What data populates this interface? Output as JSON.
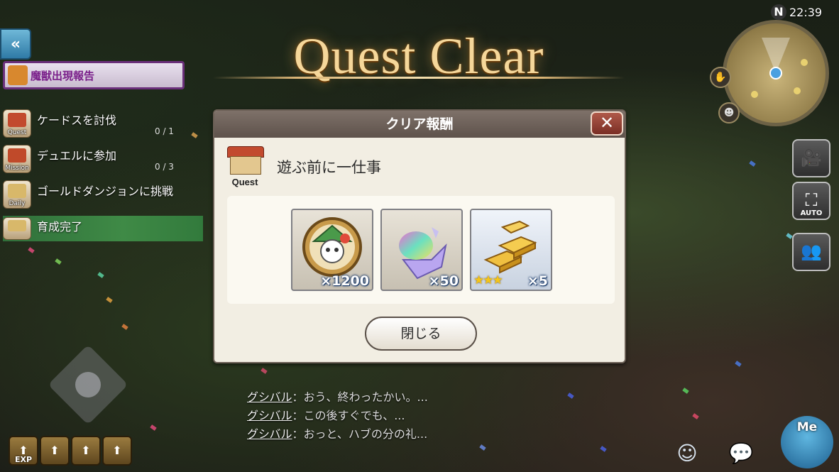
{
  "title": "Quest Clear",
  "clock": "22:39",
  "compass": "N",
  "back_button": "«",
  "event_banner": {
    "label": "魔獣出現報告"
  },
  "missions": [
    {
      "category": "Quest",
      "label": "ケードスを討伐",
      "progress": "0 / 1"
    },
    {
      "category": "Mission",
      "label": "デュエルに参加",
      "progress": "0 / 3"
    },
    {
      "category": "Daily",
      "label": "ゴールドダンジョンに挑戦",
      "progress": ""
    },
    {
      "category": "",
      "label": "育成完了",
      "progress": ""
    }
  ],
  "dialog": {
    "header": "クリア報酬",
    "close_glyph": "✕",
    "quest_icon_label": "Quest",
    "quest_name": "遊ぶ前に一仕事",
    "rewards": [
      {
        "icon": "coin-medal-icon",
        "quantity": "×1200",
        "stars": ""
      },
      {
        "icon": "rainbow-crystal-icon",
        "quantity": "×50",
        "stars": ""
      },
      {
        "icon": "gold-bars-icon",
        "quantity": "×5",
        "stars": "★★★"
      }
    ],
    "close_button": "閉じる"
  },
  "side_buttons": [
    {
      "icon": "camera-icon",
      "label": ""
    },
    {
      "icon": "auto-icon",
      "label": "AUTO"
    },
    {
      "icon": "party-icon",
      "label": ""
    }
  ],
  "chat": [
    {
      "speaker": "グシバル",
      "text": "：おう、終わったかい。..."
    },
    {
      "speaker": "グシバル",
      "text": "：この後すぐでも、..."
    },
    {
      "speaker": "グシバル",
      "text": "：おっと、ハブの分の礼..."
    }
  ],
  "bottom_left": {
    "exp_label": "EXP"
  },
  "menu": {
    "label": "Me"
  },
  "colors": {
    "title_gold": "#f5d79a",
    "dialog_header": "#6e625a",
    "mission_active": "#3f8a46"
  }
}
